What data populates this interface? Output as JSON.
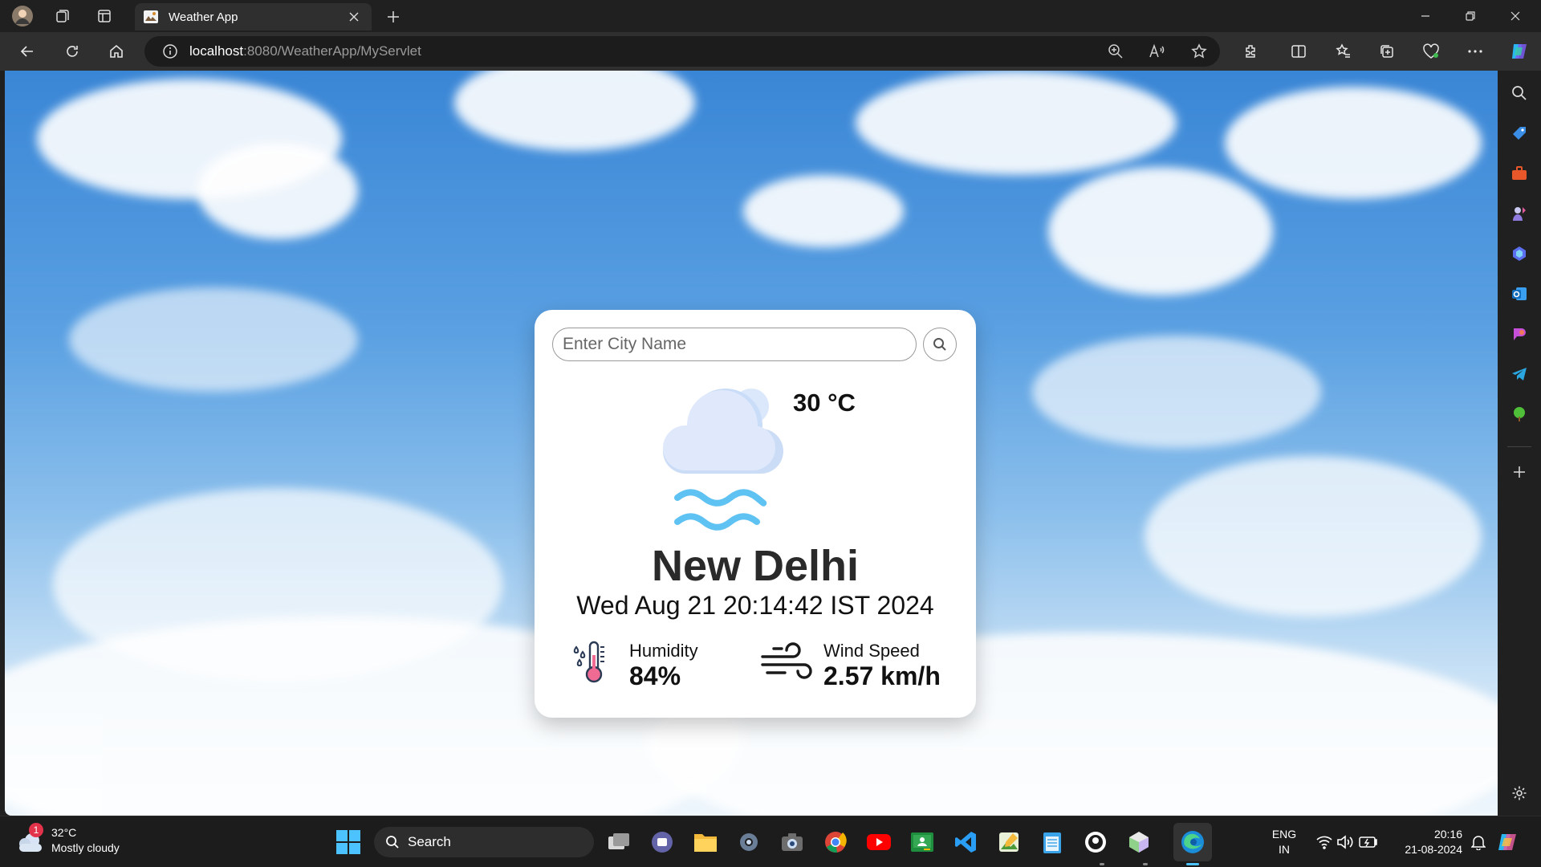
{
  "browser": {
    "tab_title": "Weather App",
    "url_host": "localhost",
    "url_rest": ":8080/WeatherApp/MyServlet"
  },
  "weather_card": {
    "search_placeholder": "Enter City Name",
    "temperature": "30 °C",
    "city": "New Delhi",
    "datetime": "Wed Aug 21 20:14:42 IST 2024",
    "humidity_label": "Humidity",
    "humidity_value": "84%",
    "wind_label": "Wind Speed",
    "wind_value": "2.57 km/h",
    "condition_icon": "cloud-mist-icon"
  },
  "taskbar": {
    "weather_temp": "32°C",
    "weather_desc": "Mostly cloudy",
    "notification_badge": "1",
    "search_label": "Search",
    "lang_top": "ENG",
    "lang_bottom": "IN",
    "time": "20:16",
    "date": "21-08-2024"
  },
  "colors": {
    "accent": "#1a73e8",
    "card_bg": "#ffffff",
    "mist": "#5ec2f2",
    "cloud_fill": "#dfe9fb"
  }
}
